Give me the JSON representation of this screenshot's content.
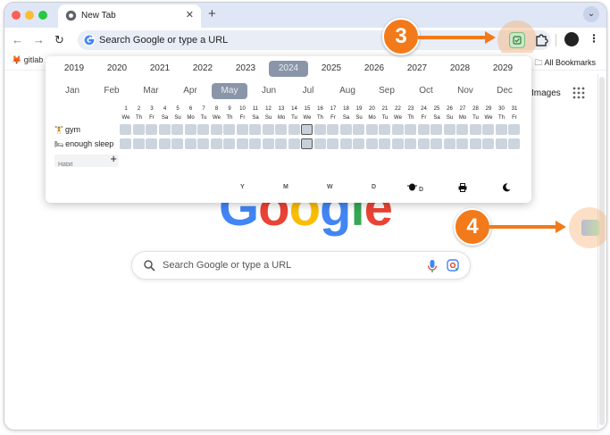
{
  "browser": {
    "tab": {
      "title": "New Tab",
      "close_icon": "close-icon"
    },
    "new_tab_label": "+",
    "tab_menu_label": "⌄",
    "omnibox_text": "Search Google or type a URL",
    "nav": {
      "back": "←",
      "forward": "→",
      "reload": "↻"
    },
    "kebab": "⋮",
    "colors": {
      "tabstrip": "#dfe7f6",
      "omnibox": "#e9eef6",
      "accent": "#f27a1a"
    }
  },
  "bookmarks": {
    "gitlab": "gitlab",
    "all": "All Bookmarks"
  },
  "newtab": {
    "images_link": "Images",
    "search_placeholder": "Search Google or type a URL"
  },
  "popup": {
    "years": [
      "2019",
      "2020",
      "2021",
      "2022",
      "2023",
      "2024",
      "2025",
      "2026",
      "2027",
      "2028",
      "2029"
    ],
    "selected_year": "2024",
    "months": [
      "Jan",
      "Feb",
      "Mar",
      "Apr",
      "May",
      "Jun",
      "Jul",
      "Aug",
      "Sep",
      "Oct",
      "Nov",
      "Dec"
    ],
    "selected_month": "May",
    "day_numbers": [
      "1",
      "2",
      "3",
      "4",
      "5",
      "6",
      "7",
      "8",
      "9",
      "10",
      "11",
      "12",
      "13",
      "14",
      "15",
      "16",
      "17",
      "18",
      "19",
      "20",
      "21",
      "22",
      "23",
      "24",
      "25",
      "26",
      "27",
      "28",
      "29",
      "30",
      "31"
    ],
    "weekdays": [
      "We",
      "Th",
      "Fr",
      "Sa",
      "Su",
      "Mo",
      "Tu",
      "We",
      "Th",
      "Fr",
      "Sa",
      "Su",
      "Mo",
      "Tu",
      "We",
      "Th",
      "Fr",
      "Sa",
      "Su",
      "Mo",
      "Tu",
      "We",
      "Th",
      "Fr",
      "Sa",
      "Su",
      "Mo",
      "Tu",
      "We",
      "Th",
      "Fr"
    ],
    "today_day": 15,
    "habits": [
      {
        "icon": "🏋",
        "name": "gym"
      },
      {
        "icon": "🛏",
        "name": "enough sleep"
      }
    ],
    "habit_placeholder": "Habit",
    "add_label": "+",
    "footer_keys": [
      "Y",
      "M",
      "W",
      "D"
    ],
    "footer_icons": [
      "bug-icon",
      "print-icon",
      "moon-icon"
    ],
    "footer_bug_key": "D"
  },
  "callouts": [
    "3",
    "4"
  ]
}
